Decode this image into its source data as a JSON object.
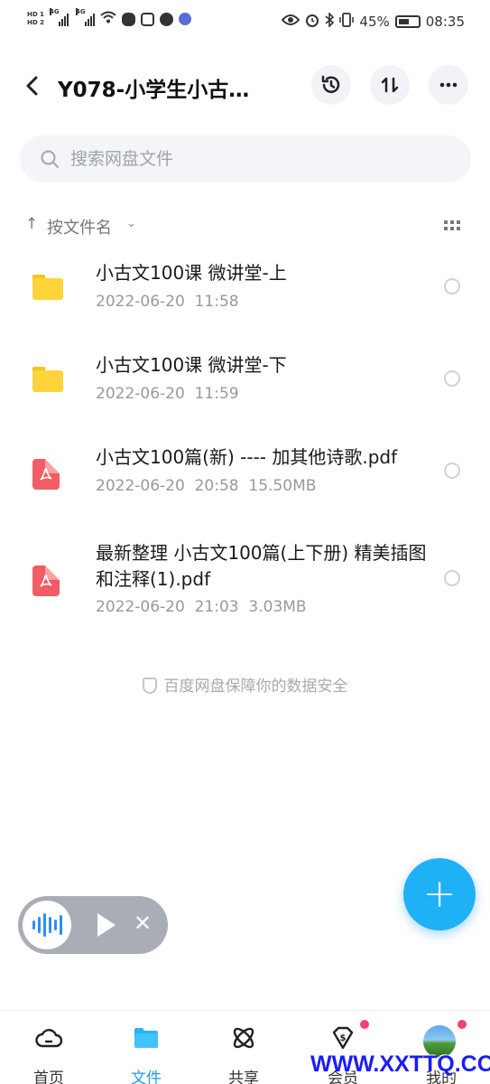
{
  "status_bar": {
    "hd1": "HD 1",
    "hd2": "HD 2",
    "net1": "4G",
    "net2": "4G",
    "battery_pct": "45%",
    "time": "08:35"
  },
  "header": {
    "title": "Y078-小学生小古…",
    "icons": [
      "back-icon",
      "history-icon",
      "sort-transfer-icon",
      "more-icon"
    ]
  },
  "search": {
    "placeholder": "搜索网盘文件"
  },
  "sort": {
    "arrow": "↑",
    "label": "按文件名",
    "chevron": "⌄"
  },
  "files": [
    {
      "type": "folder",
      "name": "小古文100课 微讲堂-上",
      "meta": "2022-06-20  11:58"
    },
    {
      "type": "folder",
      "name": "小古文100课 微讲堂-下",
      "meta": "2022-06-20  11:59"
    },
    {
      "type": "pdf",
      "name": "小古文100篇(新) ---- 加其他诗歌.pdf",
      "meta": "2022-06-20  20:58  15.50MB"
    },
    {
      "type": "pdf",
      "name": "最新整理  小古文100篇(上下册) 精美插图和注释(1).pdf",
      "meta": "2022-06-20  21:03  3.03MB"
    }
  ],
  "footer_note": "百度网盘保障你的数据安全",
  "fab": {
    "symbol": "+"
  },
  "audio_player": {
    "close": "✕"
  },
  "nav": [
    {
      "label": "首页",
      "active": false
    },
    {
      "label": "文件",
      "active": true
    },
    {
      "label": "共享",
      "active": false
    },
    {
      "label": "会员",
      "active": false
    },
    {
      "label": "我的",
      "active": false
    }
  ],
  "watermark": "WWW.XXTTQ.COM",
  "colors": {
    "accent": "#1e9cf0",
    "fab": "#1eb1f6",
    "folder": "#ffd43a",
    "pdf": "#f25c64",
    "badge": "#f4436c"
  }
}
